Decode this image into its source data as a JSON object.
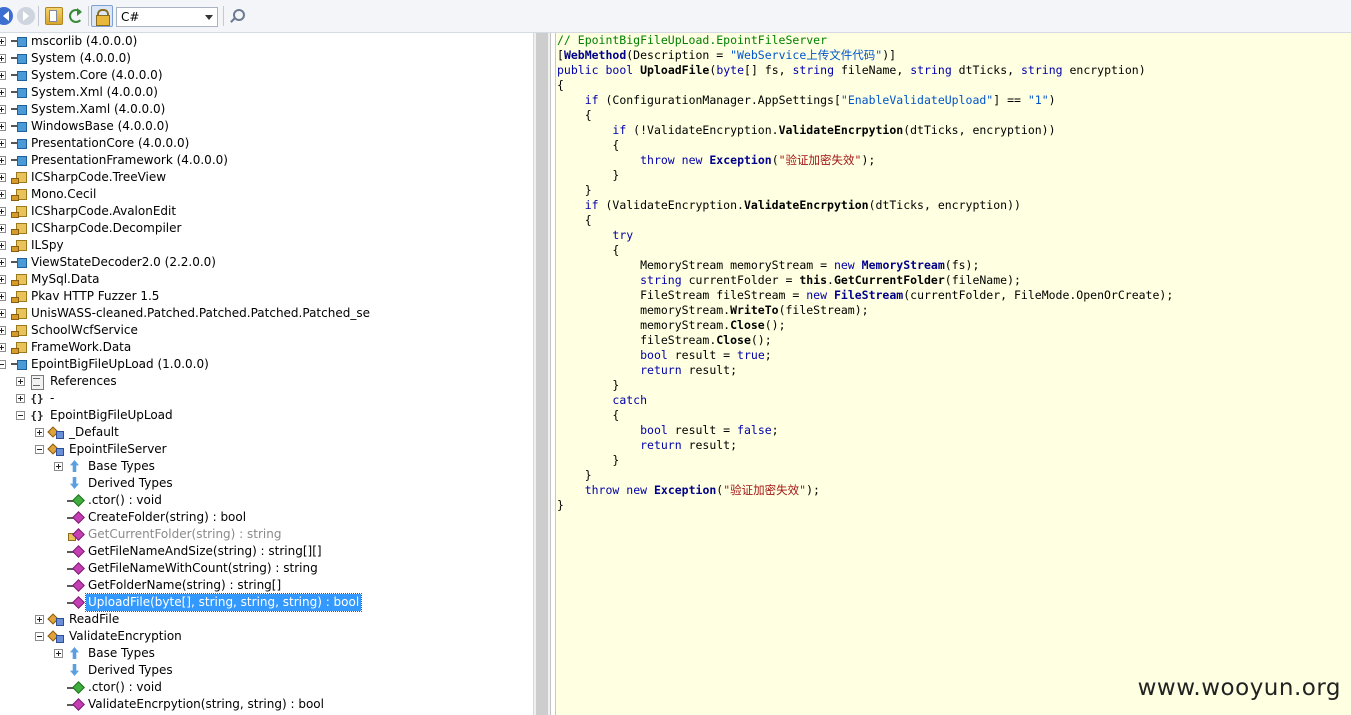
{
  "toolbar": {
    "language": "C#"
  },
  "tree": {
    "rows": [
      {
        "label": "mscorlib (4.0.0.0)",
        "icon": "assembly-icon",
        "indent": 0,
        "expander": "plus"
      },
      {
        "label": "System (4.0.0.0)",
        "icon": "assembly-icon",
        "indent": 0,
        "expander": "plus"
      },
      {
        "label": "System.Core (4.0.0.0)",
        "icon": "assembly-icon",
        "indent": 0,
        "expander": "plus"
      },
      {
        "label": "System.Xml (4.0.0.0)",
        "icon": "assembly-icon",
        "indent": 0,
        "expander": "plus"
      },
      {
        "label": "System.Xaml (4.0.0.0)",
        "icon": "assembly-icon",
        "indent": 0,
        "expander": "plus"
      },
      {
        "label": "WindowsBase (4.0.0.0)",
        "icon": "assembly-icon",
        "indent": 0,
        "expander": "plus"
      },
      {
        "label": "PresentationCore (4.0.0.0)",
        "icon": "assembly-icon",
        "indent": 0,
        "expander": "plus"
      },
      {
        "label": "PresentationFramework (4.0.0.0)",
        "icon": "assembly-icon",
        "indent": 0,
        "expander": "plus"
      },
      {
        "label": "ICSharpCode.TreeView",
        "icon": "assembly-key-icon",
        "indent": 0,
        "expander": "plus"
      },
      {
        "label": "Mono.Cecil",
        "icon": "assembly-key-icon",
        "indent": 0,
        "expander": "plus"
      },
      {
        "label": "ICSharpCode.AvalonEdit",
        "icon": "assembly-key-icon",
        "indent": 0,
        "expander": "plus"
      },
      {
        "label": "ICSharpCode.Decompiler",
        "icon": "assembly-key-icon",
        "indent": 0,
        "expander": "plus"
      },
      {
        "label": "ILSpy",
        "icon": "assembly-key-icon",
        "indent": 0,
        "expander": "plus"
      },
      {
        "label": "ViewStateDecoder2.0 (2.2.0.0)",
        "icon": "assembly-icon",
        "indent": 0,
        "expander": "plus"
      },
      {
        "label": "MySql.Data",
        "icon": "assembly-key-icon",
        "indent": 0,
        "expander": "plus"
      },
      {
        "label": "Pkav HTTP Fuzzer 1.5",
        "icon": "assembly-key-icon",
        "indent": 0,
        "expander": "plus"
      },
      {
        "label": "UnisWASS-cleaned.Patched.Patched.Patched.Patched_se",
        "icon": "assembly-key-icon",
        "indent": 0,
        "expander": "plus"
      },
      {
        "label": "SchoolWcfService",
        "icon": "assembly-key-icon",
        "indent": 0,
        "expander": "plus"
      },
      {
        "label": "FrameWork.Data",
        "icon": "assembly-key-icon",
        "indent": 0,
        "expander": "plus"
      },
      {
        "label": "EpointBigFileUpLoad (1.0.0.0)",
        "icon": "assembly-icon",
        "indent": 0,
        "expander": "minus"
      },
      {
        "label": "References",
        "icon": "references-icon",
        "indent": 1,
        "expander": "plus"
      },
      {
        "label": "-",
        "icon": "namespace-icon",
        "indent": 1,
        "expander": "plus"
      },
      {
        "label": "EpointBigFileUpLoad",
        "icon": "namespace-icon",
        "indent": 1,
        "expander": "minus"
      },
      {
        "label": "_Default",
        "icon": "class-icon",
        "indent": 2,
        "expander": "plus"
      },
      {
        "label": "EpointFileServer",
        "icon": "class-icon",
        "indent": 2,
        "expander": "minus"
      },
      {
        "label": "Base Types",
        "icon": "base-types-icon",
        "indent": 3,
        "expander": "plus"
      },
      {
        "label": "Derived Types",
        "icon": "derived-types-icon",
        "indent": 3,
        "expander": "none"
      },
      {
        "label": ".ctor() : void",
        "icon": "constructor-icon",
        "indent": 3,
        "expander": "none"
      },
      {
        "label": "CreateFolder(string) : bool",
        "icon": "method-icon",
        "indent": 3,
        "expander": "none"
      },
      {
        "label": "GetCurrentFolder(string) : string",
        "icon": "private-method-icon",
        "indent": 3,
        "expander": "none",
        "dim": true
      },
      {
        "label": "GetFileNameAndSize(string) : string[][]",
        "icon": "method-icon",
        "indent": 3,
        "expander": "none"
      },
      {
        "label": "GetFileNameWithCount(string) : string",
        "icon": "method-icon",
        "indent": 3,
        "expander": "none"
      },
      {
        "label": "GetFolderName(string) : string[]",
        "icon": "method-icon",
        "indent": 3,
        "expander": "none"
      },
      {
        "label": "UploadFile(byte[], string, string, string) : bool",
        "icon": "method-icon",
        "indent": 3,
        "expander": "none",
        "selected": true
      },
      {
        "label": "ReadFile",
        "icon": "class-icon",
        "indent": 2,
        "expander": "plus"
      },
      {
        "label": "ValidateEncryption",
        "icon": "class-icon",
        "indent": 2,
        "expander": "minus"
      },
      {
        "label": "Base Types",
        "icon": "base-types-icon",
        "indent": 3,
        "expander": "plus"
      },
      {
        "label": "Derived Types",
        "icon": "derived-types-icon",
        "indent": 3,
        "expander": "none"
      },
      {
        "label": ".ctor() : void",
        "icon": "constructor-icon",
        "indent": 3,
        "expander": "none"
      },
      {
        "label": "ValidateEncrpytion(string, string) : bool",
        "icon": "method-icon",
        "indent": 3,
        "expander": "none"
      }
    ]
  },
  "code": {
    "lines": [
      [
        [
          "c",
          "// EpointBigFileUpLoad.EpointFileServer"
        ]
      ],
      [
        [
          "p",
          "["
        ],
        [
          "ty",
          "WebMethod"
        ],
        [
          "p",
          "(Description = "
        ],
        [
          "s2",
          "\"WebService上传文件代码\""
        ],
        [
          "p",
          ")]"
        ]
      ],
      [
        [
          "kb",
          "public"
        ],
        [
          "p",
          " "
        ],
        [
          "kb",
          "bool"
        ],
        [
          "p",
          " "
        ],
        [
          "t",
          "UploadFile"
        ],
        [
          "p",
          "("
        ],
        [
          "kb",
          "byte"
        ],
        [
          "p",
          "[] fs, "
        ],
        [
          "kb",
          "string"
        ],
        [
          "p",
          " fileName, "
        ],
        [
          "kb",
          "string"
        ],
        [
          "p",
          " dtTicks, "
        ],
        [
          "kb",
          "string"
        ],
        [
          "p",
          " encryption)"
        ]
      ],
      [
        [
          "p",
          "{"
        ]
      ],
      [
        [
          "p",
          "    "
        ],
        [
          "kb",
          "if"
        ],
        [
          "p",
          " (ConfigurationManager.AppSettings["
        ],
        [
          "s2",
          "\"EnableValidateUpload\""
        ],
        [
          "p",
          "] == "
        ],
        [
          "s2",
          "\"1\""
        ],
        [
          "p",
          ")"
        ]
      ],
      [
        [
          "p",
          "    {"
        ]
      ],
      [
        [
          "p",
          "        "
        ],
        [
          "kb",
          "if"
        ],
        [
          "p",
          " (!ValidateEncryption."
        ],
        [
          "t",
          "ValidateEncrpytion"
        ],
        [
          "p",
          "(dtTicks, encryption))"
        ]
      ],
      [
        [
          "p",
          "        {"
        ]
      ],
      [
        [
          "p",
          "            "
        ],
        [
          "kb",
          "throw"
        ],
        [
          "p",
          " "
        ],
        [
          "kb",
          "new"
        ],
        [
          "p",
          " "
        ],
        [
          "ty",
          "Exception"
        ],
        [
          "p",
          "("
        ],
        [
          "s",
          "\"验证加密失效\""
        ],
        [
          "p",
          ");"
        ]
      ],
      [
        [
          "p",
          "        }"
        ]
      ],
      [
        [
          "p",
          "    }"
        ]
      ],
      [
        [
          "p",
          "    "
        ],
        [
          "kb",
          "if"
        ],
        [
          "p",
          " (ValidateEncryption."
        ],
        [
          "t",
          "ValidateEncrpytion"
        ],
        [
          "p",
          "(dtTicks, encryption))"
        ]
      ],
      [
        [
          "p",
          "    {"
        ]
      ],
      [
        [
          "p",
          "        "
        ],
        [
          "kb",
          "try"
        ]
      ],
      [
        [
          "p",
          "        {"
        ]
      ],
      [
        [
          "p",
          "            MemoryStream memoryStream = "
        ],
        [
          "kb",
          "new"
        ],
        [
          "p",
          " "
        ],
        [
          "ty",
          "MemoryStream"
        ],
        [
          "p",
          "(fs);"
        ]
      ],
      [
        [
          "p",
          "            "
        ],
        [
          "kb",
          "string"
        ],
        [
          "p",
          " currentFolder = "
        ],
        [
          "t",
          "this"
        ],
        [
          "p",
          "."
        ],
        [
          "t",
          "GetCurrentFolder"
        ],
        [
          "p",
          "(fileName);"
        ]
      ],
      [
        [
          "p",
          "            FileStream fileStream = "
        ],
        [
          "kb",
          "new"
        ],
        [
          "p",
          " "
        ],
        [
          "ty",
          "FileStream"
        ],
        [
          "p",
          "(currentFolder, FileMode.OpenOrCreate);"
        ]
      ],
      [
        [
          "p",
          "            memoryStream."
        ],
        [
          "t",
          "WriteTo"
        ],
        [
          "p",
          "(fileStream);"
        ]
      ],
      [
        [
          "p",
          "            memoryStream."
        ],
        [
          "t",
          "Close"
        ],
        [
          "p",
          "();"
        ]
      ],
      [
        [
          "p",
          "            fileStream."
        ],
        [
          "t",
          "Close"
        ],
        [
          "p",
          "();"
        ]
      ],
      [
        [
          "p",
          "            "
        ],
        [
          "kb",
          "bool"
        ],
        [
          "p",
          " result = "
        ],
        [
          "kb",
          "true"
        ],
        [
          "p",
          ";"
        ]
      ],
      [
        [
          "p",
          "            "
        ],
        [
          "kb",
          "return"
        ],
        [
          "p",
          " result;"
        ]
      ],
      [
        [
          "p",
          "        }"
        ]
      ],
      [
        [
          "p",
          "        "
        ],
        [
          "kb",
          "catch"
        ]
      ],
      [
        [
          "p",
          "        {"
        ]
      ],
      [
        [
          "p",
          "            "
        ],
        [
          "kb",
          "bool"
        ],
        [
          "p",
          " result = "
        ],
        [
          "kb",
          "false"
        ],
        [
          "p",
          ";"
        ]
      ],
      [
        [
          "p",
          "            "
        ],
        [
          "kb",
          "return"
        ],
        [
          "p",
          " result;"
        ]
      ],
      [
        [
          "p",
          "        }"
        ]
      ],
      [
        [
          "p",
          "    }"
        ]
      ],
      [
        [
          "p",
          "    "
        ],
        [
          "kb",
          "throw"
        ],
        [
          "p",
          " "
        ],
        [
          "kb",
          "new"
        ],
        [
          "p",
          " "
        ],
        [
          "ty",
          "Exception"
        ],
        [
          "p",
          "("
        ],
        [
          "s",
          "\"验证加密失效\""
        ],
        [
          "p",
          ");"
        ]
      ],
      [
        [
          "p",
          "}"
        ]
      ]
    ]
  },
  "watermark": "www.wooyun.org"
}
